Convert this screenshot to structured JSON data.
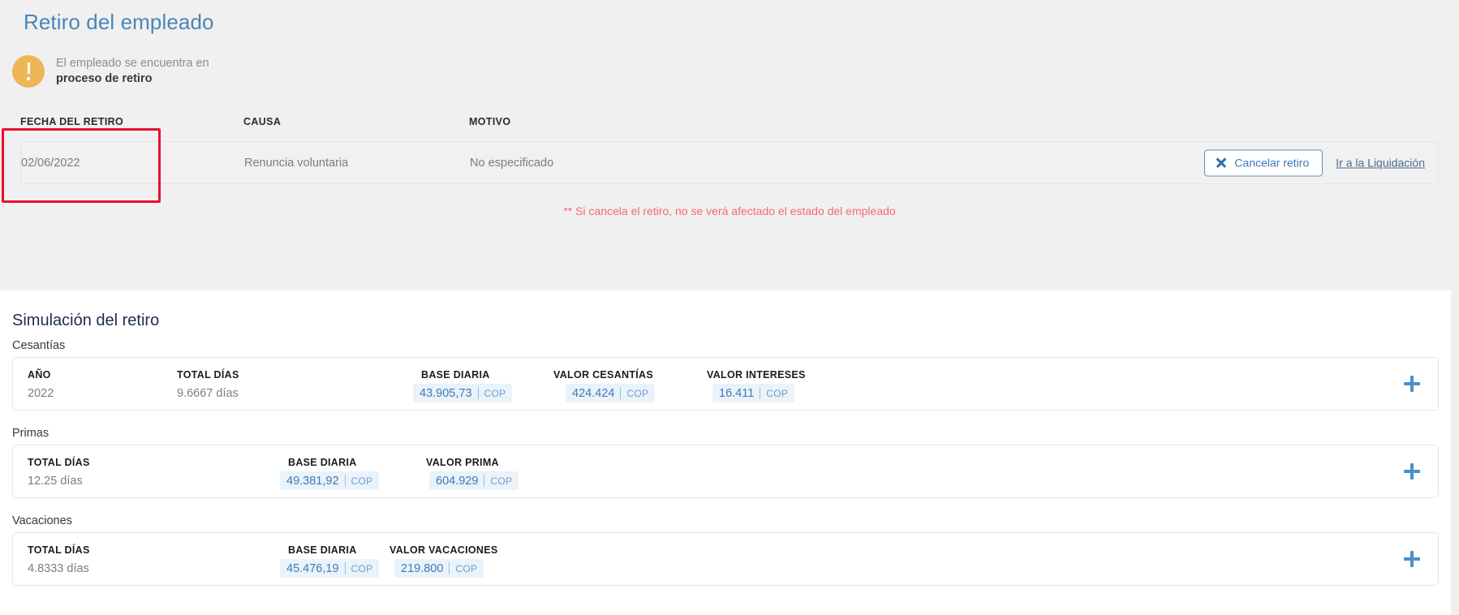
{
  "page": {
    "title": "Retiro del empleado"
  },
  "alert": {
    "icon": "exclamation-circle-icon",
    "line1": "El empleado se encuentra en",
    "line2": "proceso de retiro",
    "color": "#f0b555"
  },
  "retiro_table": {
    "headers": {
      "fecha": "FECHA DEL RETIRO",
      "causa": "CAUSA",
      "motivo": "MOTIVO"
    },
    "row": {
      "fecha": "02/06/2022",
      "causa": "Renuncia voluntaria",
      "motivo": "No especificado"
    },
    "actions": {
      "cancel_icon": "close-x-icon",
      "cancel_label": "Cancelar retiro",
      "link_label": "Ir a la Liquidación"
    },
    "highlight_color": "#e8112d"
  },
  "warning_note": {
    "text": "** Si cancela el retiro, no se verá afectado el estado del empleado",
    "color": "#f2697c"
  },
  "simulation": {
    "title": "Simulación del retiro",
    "sections": [
      {
        "label": "Cesantías",
        "headers": {
          "anio": "AÑO",
          "total_dias": "TOTAL DÍAS",
          "base_diaria": "BASE DIARIA",
          "valor_cesantias": "VALOR CESANTÍAS",
          "valor_intereses": "VALOR INTERESES"
        },
        "values": {
          "anio": "2022",
          "total_dias": "9.6667 días",
          "base_diaria": "43.905,73",
          "base_diaria_currency": "COP",
          "valor_cesantias": "424.424",
          "valor_cesantias_currency": "COP",
          "valor_intereses": "16.411",
          "valor_intereses_currency": "COP"
        },
        "expand_icon": "plus-icon"
      },
      {
        "label": "Primas",
        "headers": {
          "total_dias": "TOTAL DÍAS",
          "base_diaria": "BASE DIARIA",
          "valor_prima": "VALOR PRIMA"
        },
        "values": {
          "total_dias": "12.25 días",
          "base_diaria": "49.381,92",
          "base_diaria_currency": "COP",
          "valor_prima": "604.929",
          "valor_prima_currency": "COP"
        },
        "expand_icon": "plus-icon"
      },
      {
        "label": "Vacaciones",
        "headers": {
          "total_dias": "TOTAL DÍAS",
          "base_diaria": "BASE DIARIA",
          "valor_vacaciones": "VALOR VACACIONES"
        },
        "values": {
          "total_dias": "4.8333 días",
          "base_diaria": "45.476,19",
          "base_diaria_currency": "COP",
          "valor_vacaciones": "219.800",
          "valor_vacaciones_currency": "COP"
        },
        "expand_icon": "plus-icon"
      }
    ]
  },
  "colors": {
    "title_blue": "#4a86b8",
    "accent_blue": "#3d7ab8",
    "chip_bg": "#eaf2fa",
    "page_bg_top": "#f0f0f0"
  }
}
